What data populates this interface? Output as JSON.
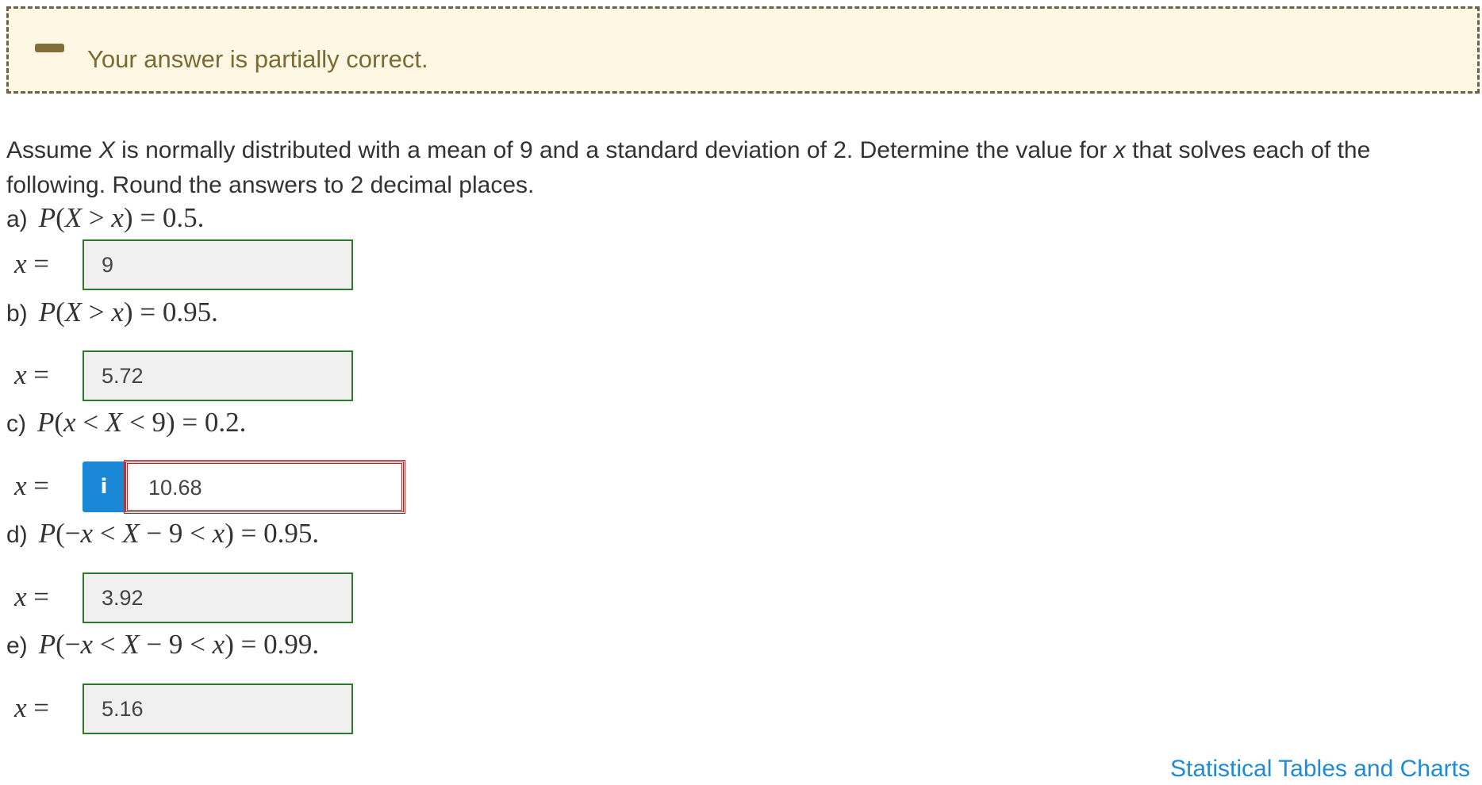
{
  "banner": {
    "status_text": "Your answer is partially correct.",
    "icon": "minus-icon",
    "background": "#fdf7e3",
    "text_color": "#7a6a33"
  },
  "question": {
    "text_before_X": "Assume ",
    "X": "X",
    "text_after_X": " is normally distributed with a mean of 9 and a standard deviation of 2. Determine the value for ",
    "x": "x",
    "text_after_x": " that solves each of the following. Round the answers to 2 decimal places."
  },
  "parts": [
    {
      "letter": "a)",
      "expression": "P(X > x) = 0.5.",
      "answer_label": "x =",
      "answer": "9",
      "status": "correct"
    },
    {
      "letter": "b)",
      "expression": "P(X > x) = 0.95.",
      "answer_label": "x =",
      "answer": "5.72",
      "status": "correct"
    },
    {
      "letter": "c)",
      "expression": "P(x < X < 9) = 0.2.",
      "answer_label": "x =",
      "answer": "10.68",
      "status": "incorrect",
      "info_icon": "i"
    },
    {
      "letter": "d)",
      "expression": "P(−x < X − 9 < x) = 0.95.",
      "answer_label": "x =",
      "answer": "3.92",
      "status": "correct"
    },
    {
      "letter": "e)",
      "expression": "P(−x < X − 9 < x) = 0.99.",
      "answer_label": "x =",
      "answer": "5.16",
      "status": "correct"
    }
  ],
  "footer": {
    "link_text": "Statistical Tables and Charts"
  },
  "colors": {
    "correct_border": "#2d7a2d",
    "incorrect_border": "#a03030",
    "info_button": "#1a88d6",
    "link": "#1f8ad6"
  }
}
